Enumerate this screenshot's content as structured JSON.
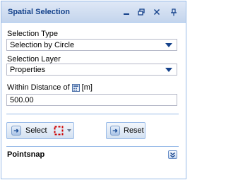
{
  "window": {
    "title": "Spatial Selection",
    "tools": [
      "minimize-icon",
      "restore-icon",
      "close-icon",
      "pin-icon"
    ]
  },
  "form": {
    "selection_type": {
      "label": "Selection Type",
      "value": "Selection by Circle"
    },
    "selection_layer": {
      "label": "Selection Layer",
      "value": "Properties"
    },
    "distance": {
      "label": "Within Distance of",
      "unit": "[m]",
      "value": "500.00"
    }
  },
  "buttons": {
    "select_label": "Select",
    "reset_label": "Reset"
  },
  "pointsnap": {
    "title": "Pointsnap"
  },
  "colors": {
    "title_text": "#15428b",
    "border": "#99bbe8",
    "select_marker": "#cc0000"
  }
}
